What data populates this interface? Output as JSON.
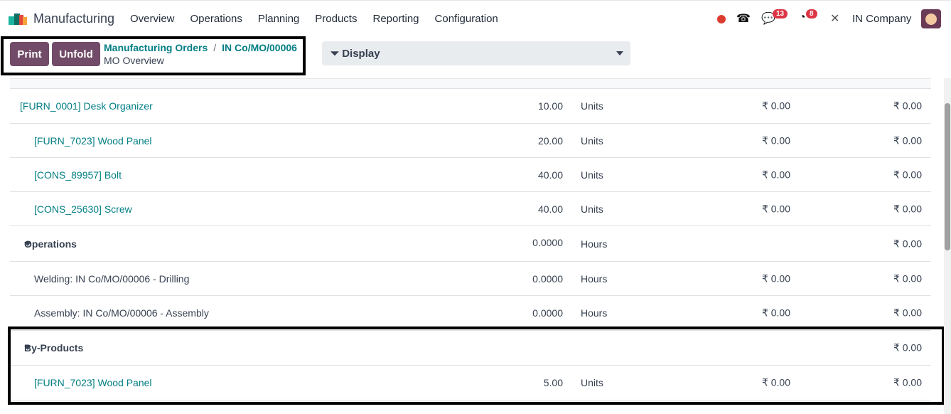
{
  "nav": {
    "app": "Manufacturing",
    "menu": [
      "Overview",
      "Operations",
      "Planning",
      "Products",
      "Reporting",
      "Configuration"
    ],
    "messages_count": "13",
    "activities_count": "8",
    "company": "IN Company"
  },
  "control": {
    "print": "Print",
    "unfold": "Unfold",
    "breadcrumb": [
      "Manufacturing Orders",
      "IN Co/MO/00006"
    ],
    "separator": "/",
    "subtitle": "MO Overview",
    "display": "Display"
  },
  "rows": [
    {
      "type": "item",
      "level": 0,
      "name": "[FURN_0001] Desk Organizer",
      "qty": "10.00",
      "unit": "Units",
      "cost": "₹ 0.00",
      "total": "₹ 0.00"
    },
    {
      "type": "item",
      "level": 1,
      "name": "[FURN_7023] Wood Panel",
      "qty": "20.00",
      "unit": "Units",
      "cost": "₹ 0.00",
      "total": "₹ 0.00"
    },
    {
      "type": "item",
      "level": 1,
      "name": "[CONS_89957] Bolt",
      "qty": "40.00",
      "unit": "Units",
      "cost": "₹ 0.00",
      "total": "₹ 0.00"
    },
    {
      "type": "item",
      "level": 1,
      "name": "[CONS_25630] Screw",
      "qty": "40.00",
      "unit": "Units",
      "cost": "₹ 0.00",
      "total": "₹ 0.00"
    },
    {
      "type": "section",
      "name": "Operations",
      "qty": "0.0000",
      "unit": "Hours",
      "cost": "",
      "total": "₹ 0.00"
    },
    {
      "type": "op",
      "name": "Welding: IN Co/MO/00006 - Drilling",
      "qty": "0.0000",
      "unit": "Hours",
      "cost": "₹ 0.00",
      "total": "₹ 0.00"
    },
    {
      "type": "op",
      "name": "Assembly: IN Co/MO/00006 - Assembly",
      "qty": "0.0000",
      "unit": "Hours",
      "cost": "₹ 0.00",
      "total": "₹ 0.00"
    },
    {
      "type": "section",
      "name": "By-Products",
      "qty": "",
      "unit": "",
      "cost": "",
      "total": "₹ 0.00"
    },
    {
      "type": "item",
      "level": 1,
      "name": "[FURN_7023] Wood Panel",
      "qty": "5.00",
      "unit": "Units",
      "cost": "₹ 0.00",
      "total": "₹ 0.00"
    }
  ]
}
